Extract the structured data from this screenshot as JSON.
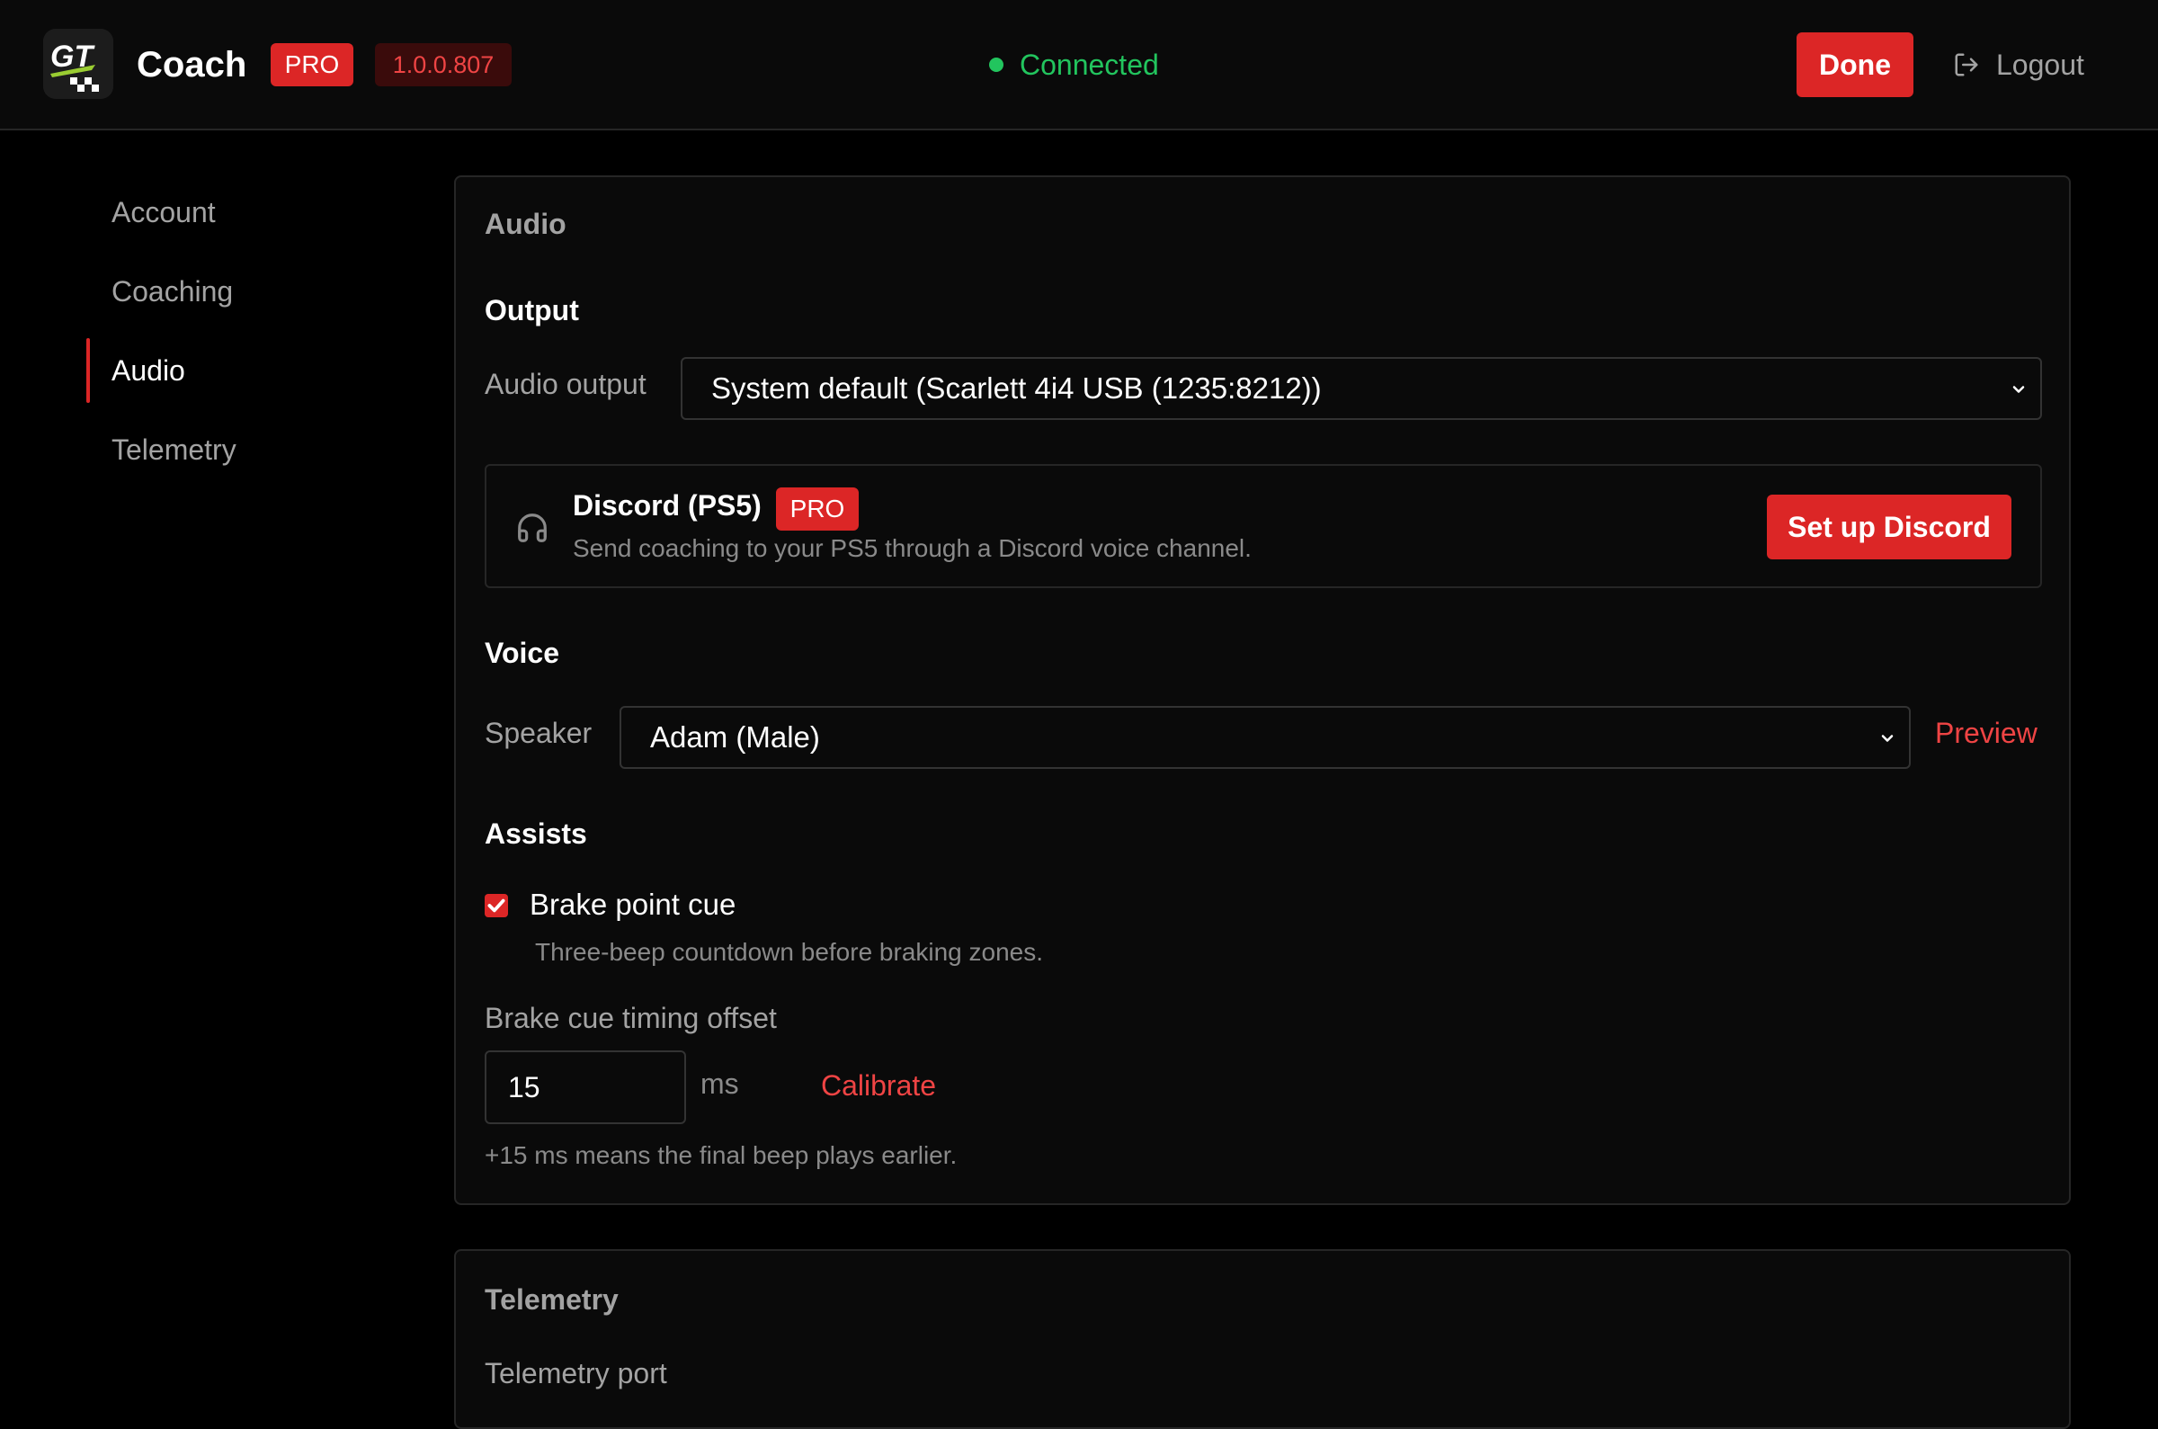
{
  "header": {
    "app_title": "Coach",
    "pro_badge": "PRO",
    "version": "1.0.0.807",
    "status": "Connected",
    "done_label": "Done",
    "logout_label": "Logout",
    "logo_icon": "gt-logo-icon"
  },
  "colors": {
    "accent": "#dc2626",
    "status_ok": "#22c55e",
    "background": "#000000",
    "panel": "#0a0a0a"
  },
  "sidebar": {
    "items": [
      {
        "label": "Account",
        "active": false
      },
      {
        "label": "Coaching",
        "active": false
      },
      {
        "label": "Audio",
        "active": true
      },
      {
        "label": "Telemetry",
        "active": false
      }
    ]
  },
  "audio": {
    "card_title": "Audio",
    "output": {
      "section_title": "Output",
      "label": "Audio output",
      "selected": "System default (Scarlett 4i4 USB (1235:8212))"
    },
    "discord": {
      "icon": "headphones-icon",
      "title": "Discord (PS5)",
      "badge": "PRO",
      "description": "Send coaching to your PS5 through a Discord voice channel.",
      "button_label": "Set up Discord"
    },
    "voice": {
      "section_title": "Voice",
      "label": "Speaker",
      "selected": "Adam (Male)",
      "preview_label": "Preview"
    },
    "assists": {
      "section_title": "Assists",
      "brake_cue_label": "Brake point cue",
      "brake_cue_checked": true,
      "brake_cue_help": "Three-beep countdown before braking zones.",
      "offset_label": "Brake cue timing offset",
      "offset_value": "15",
      "offset_unit": "ms",
      "calibrate_label": "Calibrate",
      "offset_help": "+15 ms means the final beep plays earlier."
    }
  },
  "telemetry": {
    "card_title": "Telemetry",
    "port_label": "Telemetry port"
  }
}
